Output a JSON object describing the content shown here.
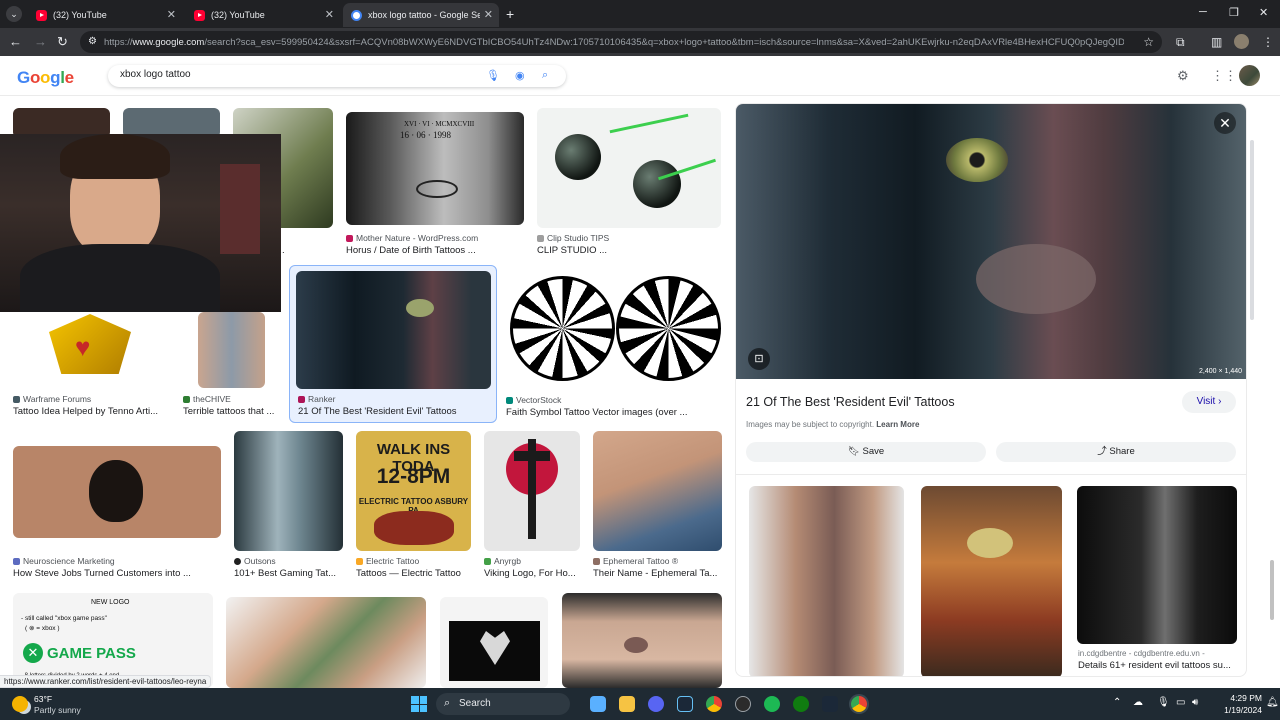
{
  "browser": {
    "tabs": [
      {
        "title": "(32) YouTube",
        "favicon": "youtube-icon"
      },
      {
        "title": "(32) YouTube",
        "favicon": "youtube-icon"
      },
      {
        "title": "xbox logo tattoo - Google Sear",
        "favicon": "google-icon"
      }
    ],
    "url_prefix": "https://",
    "url_host": "www.google.com",
    "url_rest": "/search?sca_esv=599950424&sxsrf=ACQVn08bWXWyE6NDVGTbICBO54UhTz4NDw:1705710106435&q=xbox+logo+tattoo&tbm=isch&source=lnms&sa=X&ved=2ahUKEwjrku-n2eqDAxVRle4BHexHCFUQ0pQJegQIDBAB&bi..."
  },
  "header": {
    "logo_letters": [
      "G",
      "o",
      "o",
      "g",
      "l",
      "e"
    ],
    "search_value": "xbox logo tattoo"
  },
  "grid": {
    "row1": [
      {
        "source": "",
        "title": "ee Tattoos..."
      },
      {
        "source": "Mother Nature - WordPress.com",
        "title": "Horus / Date of Birth Tattoos ..."
      },
      {
        "source": "Clip Studio TIPS",
        "title": "CLIP STUDIO ..."
      }
    ],
    "row2": [
      {
        "source": "Warframe Forums",
        "title": "Tattoo Idea Helped by Tenno Arti..."
      },
      {
        "source": "theCHIVE",
        "title": "Terrible tattoos that ..."
      },
      {
        "source": "Ranker",
        "title": "21 Of The Best 'Resident Evil' Tattoos"
      },
      {
        "source": "VectorStock",
        "title": "Faith Symbol Tattoo Vector images (over ..."
      }
    ],
    "row3": [
      {
        "source": "Neuroscience Marketing",
        "title": "How Steve Jobs Turned Customers into ..."
      },
      {
        "source": "Outsons",
        "title": "101+ Best Gaming Tat..."
      },
      {
        "source": "Electric Tattoo",
        "title": "Tattoos — Electric Tattoo"
      },
      {
        "source": "Anyrgb",
        "title": "Viking Logo, For Ho..."
      },
      {
        "source": "Ephemeral Tattoo ®",
        "title": "Their Name - Ephemeral Ta..."
      }
    ],
    "image_text": {
      "horus_line1": "XVI · VI · MCMXCVIII",
      "horus_line2": "16 · 06 · 1998",
      "walk_ins_line1": "WALK INS TODA",
      "walk_ins_line2": "12-8PM",
      "walk_ins_line3": "ELECTRIC TATTOO ASBURY PA",
      "gamepass_heading": "NEW LOGO",
      "gamepass_sub": "- still called \"xbox game pass\"",
      "gamepass_sub2": "( ⊗ = xbox )",
      "gamepass_word": "GAME PASS",
      "gamepass_note": "- 8 letters divided by 2 words + 4 end"
    }
  },
  "preview": {
    "dimensions": "2,400 × 1,440",
    "title": "21 Of The Best 'Resident Evil' Tattoos",
    "visit_label": "Visit",
    "copyright_text": "Images may be subject to copyright.",
    "learn_more": "Learn More",
    "save_label": "Save",
    "share_label": "Share",
    "related_source": "in.cdgdbentre - cdgdbentre.edu.vn -",
    "related_title": "Details 61+ resident evil tattoos su..."
  },
  "status_url": "https://www.ranker.com/list/resident-evil-tattoos/leo-reyna",
  "taskbar": {
    "temperature": "63°F",
    "weather": "Partly sunny",
    "search_label": "Search",
    "time": "4:29 PM",
    "date": "1/19/2024"
  },
  "colors": {
    "google_blue": "#4285f4",
    "selected_bg": "#e8f0fe",
    "taskbar_bg": "#1f2a33",
    "chrome_dark": "#202124"
  }
}
